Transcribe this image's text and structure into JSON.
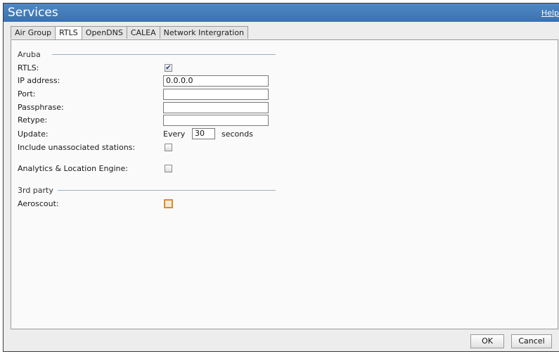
{
  "window": {
    "title": "Services",
    "help_label": "Help"
  },
  "tabs": [
    {
      "label": "Air Group",
      "active": false
    },
    {
      "label": "RTLS",
      "active": true
    },
    {
      "label": "OpenDNS",
      "active": false
    },
    {
      "label": "CALEA",
      "active": false
    },
    {
      "label": "Network Intergration",
      "active": false
    }
  ],
  "aruba": {
    "group_label": "Aruba",
    "rtls_label": "RTLS:",
    "rtls_checked": true,
    "ip_label": "IP address:",
    "ip_value": "0.0.0.0",
    "port_label": "Port:",
    "port_value": "",
    "passphrase_label": "Passphrase:",
    "passphrase_value": "",
    "retype_label": "Retype:",
    "retype_value": "",
    "update_label": "Update:",
    "update_prefix": "Every",
    "update_value": "30",
    "update_suffix": "seconds",
    "unassociated_label": "Include unassociated stations:",
    "unassociated_checked": false,
    "ale_label": "Analytics & Location Engine:",
    "ale_checked": false
  },
  "third_party": {
    "group_label": "3rd party",
    "aeroscout_label": "Aeroscout:",
    "aeroscout_checked": false
  },
  "buttons": {
    "ok_label": "OK",
    "cancel_label": "Cancel"
  },
  "colors": {
    "titlebar": "#3f78b6",
    "focus_border": "#d98c2e"
  }
}
